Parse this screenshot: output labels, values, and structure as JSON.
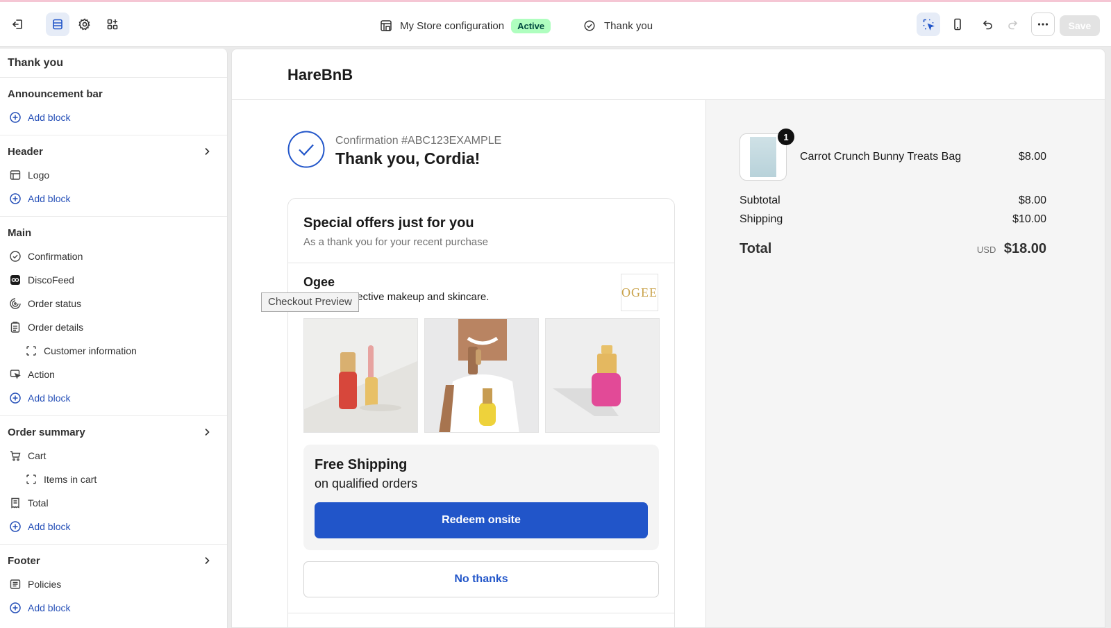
{
  "topbar": {
    "store_name": "My Store configuration",
    "status": "Active",
    "page": "Thank you",
    "save_label": "Save"
  },
  "sidebar": {
    "title": "Thank you",
    "sections": {
      "announcement": {
        "title": "Announcement bar",
        "add": "Add block"
      },
      "header": {
        "title": "Header",
        "items": [
          "Logo"
        ],
        "add": "Add block"
      },
      "main": {
        "title": "Main",
        "items": [
          "Confirmation",
          "DiscoFeed",
          "Order status",
          "Order details",
          "Customer information",
          "Action"
        ],
        "add": "Add block"
      },
      "order_summary": {
        "title": "Order summary",
        "items": [
          "Cart",
          "Items in cart",
          "Total"
        ],
        "add": "Add block"
      },
      "footer": {
        "title": "Footer",
        "items": [
          "Policies"
        ],
        "add": "Add block"
      }
    }
  },
  "preview": {
    "brand": "HareBnB",
    "tooltip": "Checkout Preview",
    "confirmation_number": "Confirmation #ABC123EXAMPLE",
    "thank_you": "Thank you, Cordia!",
    "offer": {
      "title": "Special offers just for you",
      "subtitle": "As a thank you for your recent purchase",
      "brand_name": "Ogee",
      "brand_desc": "Organic, effective makeup and skincare.",
      "brand_logo": "OGEE",
      "shipping_title": "Free Shipping",
      "shipping_sub": "on qualified orders",
      "redeem": "Redeem onsite",
      "no_thanks": "No thanks"
    },
    "summary": {
      "item_name": "Carrot Crunch Bunny Treats Bag",
      "item_qty": "1",
      "item_price": "$8.00",
      "subtotal_label": "Subtotal",
      "subtotal": "$8.00",
      "shipping_label": "Shipping",
      "shipping": "$10.00",
      "total_label": "Total",
      "currency": "USD",
      "total": "$18.00"
    }
  },
  "colors": {
    "accent": "#2155c9",
    "active_badge": "#affebf",
    "selected_tool": "#e6ecf7"
  }
}
